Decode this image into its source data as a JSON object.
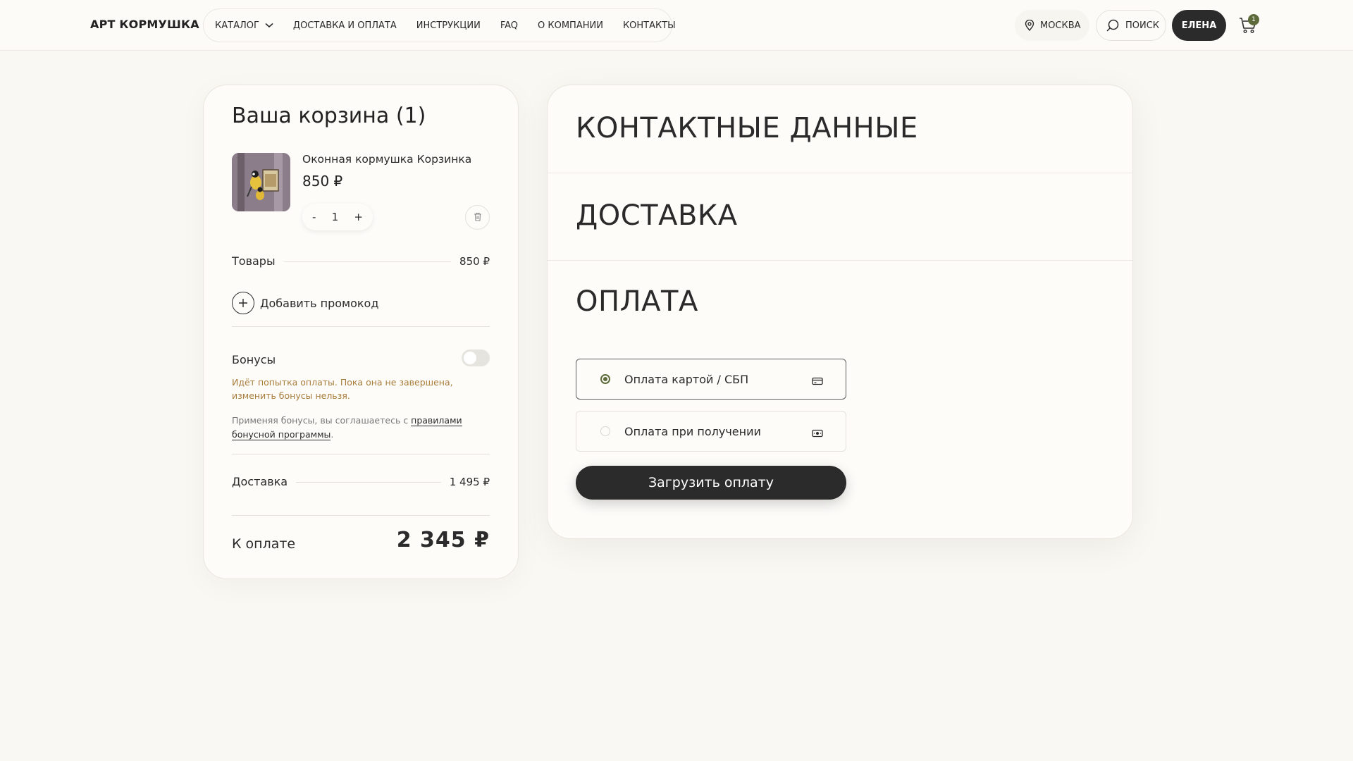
{
  "header": {
    "logo": "АРТ КОРМУШКА",
    "nav": [
      "КАТАЛОГ",
      "ДОСТАВКА И ОПЛАТА",
      "ИНСТРУКЦИИ",
      "FAQ",
      "О КОМПАНИИ",
      "КОНТАКТЫ"
    ],
    "city": "МОСКВА",
    "search": "ПОИСК",
    "user": "ЕЛЕНА",
    "cart_count": "1"
  },
  "cart": {
    "title": "Ваша корзина (1)",
    "item": {
      "name": "Оконная кормушка Корзинка",
      "price": "850 ₽",
      "qty_minus": "-",
      "qty": "1",
      "qty_plus": "+"
    },
    "goods_label": "Товары",
    "goods_value": "850 ₽",
    "promo_label": "Добавить промокод",
    "bonus_label": "Бонусы",
    "bonus_enabled": false,
    "bonus_warning": "Идёт попытка оплаты. Пока она не завершена, изменить бонусы нельзя.",
    "bonus_note_prefix": "Применяя бонусы, вы соглашаетесь с ",
    "bonus_note_link": "правилами бонусной программы",
    "bonus_note_suffix": ".",
    "delivery_label": "Доставка",
    "delivery_value": "1 495 ₽",
    "total_label": "К оплате",
    "total_value": "2 345 ₽"
  },
  "checkout": {
    "sections": [
      "КОНТАКТНЫЕ ДАННЫЕ",
      "ДОСТАВКА",
      "ОПЛАТА"
    ],
    "payment_options": [
      {
        "label": "Оплата картой / СБП",
        "selected": true,
        "icon": "card-icon"
      },
      {
        "label": "Оплата при получении",
        "selected": false,
        "icon": "cash-icon"
      }
    ],
    "submit_label": "Загрузить оплату"
  },
  "colors": {
    "background": "#faf8f3",
    "dark": "#2b2b2b",
    "accent_green": "#5d6b3a",
    "warning": "#a87c3b"
  }
}
